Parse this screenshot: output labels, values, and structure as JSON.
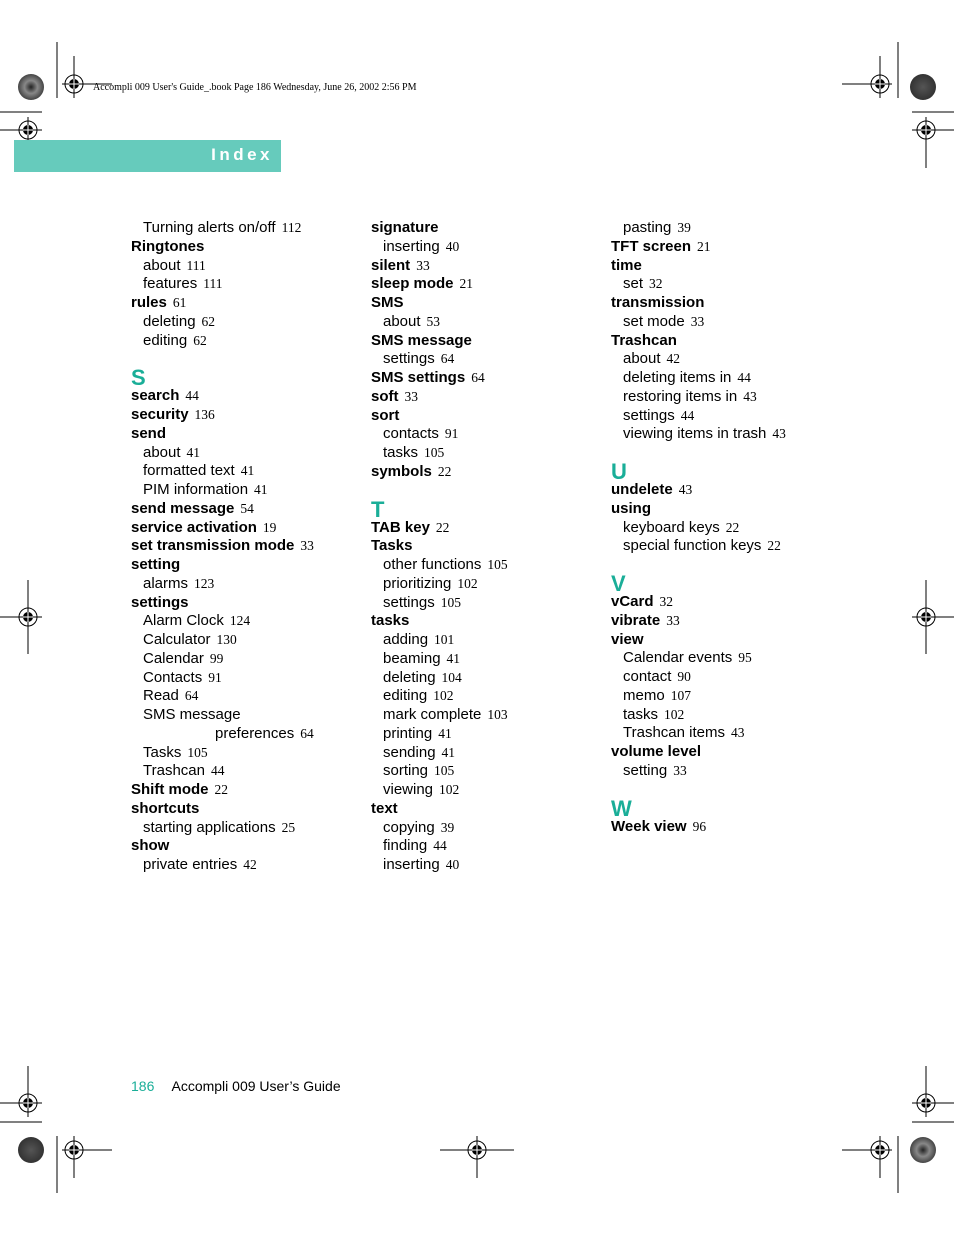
{
  "slug_line": "Accompli 009 User's Guide_.book  Page 186  Wednesday, June 26, 2002  2:56 PM",
  "banner_title": "Index",
  "columns": [
    [
      {
        "type": "sub",
        "text": "Turning alerts on/off",
        "page": "112"
      },
      {
        "type": "main",
        "text": "Ringtones",
        "page": ""
      },
      {
        "type": "sub",
        "text": "about",
        "page": "111"
      },
      {
        "type": "sub",
        "text": "features",
        "page": "111"
      },
      {
        "type": "main",
        "text": "rules",
        "page": "61"
      },
      {
        "type": "sub",
        "text": "deleting",
        "page": "62"
      },
      {
        "type": "sub",
        "text": "editing",
        "page": "62"
      },
      {
        "type": "letter",
        "text": "S"
      },
      {
        "type": "main",
        "text": "search",
        "page": "44"
      },
      {
        "type": "main",
        "text": "security",
        "page": "136"
      },
      {
        "type": "main",
        "text": "send",
        "page": ""
      },
      {
        "type": "sub",
        "text": "about",
        "page": "41"
      },
      {
        "type": "sub",
        "text": "formatted text",
        "page": "41"
      },
      {
        "type": "sub",
        "text": "PIM information",
        "page": "41"
      },
      {
        "type": "main",
        "text": "send message",
        "page": "54"
      },
      {
        "type": "main",
        "text": "service activation",
        "page": "19"
      },
      {
        "type": "main",
        "text": "set transmission mode",
        "page": "33"
      },
      {
        "type": "main",
        "text": "setting",
        "page": ""
      },
      {
        "type": "sub",
        "text": "alarms",
        "page": "123"
      },
      {
        "type": "main",
        "text": "settings",
        "page": ""
      },
      {
        "type": "sub",
        "text": "Alarm Clock",
        "page": "124"
      },
      {
        "type": "sub",
        "text": "Calculator",
        "page": "130"
      },
      {
        "type": "sub",
        "text": "Calendar",
        "page": "99"
      },
      {
        "type": "sub",
        "text": "Contacts",
        "page": "91"
      },
      {
        "type": "sub",
        "text": "Read",
        "page": "64"
      },
      {
        "type": "sub",
        "text": "SMS message",
        "page": ""
      },
      {
        "type": "sub2",
        "text": "preferences",
        "page": "64"
      },
      {
        "type": "sub",
        "text": "Tasks",
        "page": "105"
      },
      {
        "type": "sub",
        "text": "Trashcan",
        "page": "44"
      },
      {
        "type": "main",
        "text": "Shift mode",
        "page": "22"
      },
      {
        "type": "main",
        "text": "shortcuts",
        "page": ""
      },
      {
        "type": "sub",
        "text": "starting applications",
        "page": "25"
      },
      {
        "type": "main",
        "text": "show",
        "page": ""
      },
      {
        "type": "sub",
        "text": "private entries",
        "page": "42"
      }
    ],
    [
      {
        "type": "main",
        "text": "signature",
        "page": ""
      },
      {
        "type": "sub",
        "text": "inserting",
        "page": "40"
      },
      {
        "type": "main",
        "text": "silent",
        "page": "33"
      },
      {
        "type": "main",
        "text": "sleep mode",
        "page": "21"
      },
      {
        "type": "main",
        "text": "SMS",
        "page": ""
      },
      {
        "type": "sub",
        "text": "about",
        "page": "53"
      },
      {
        "type": "main",
        "text": "SMS message",
        "page": ""
      },
      {
        "type": "sub",
        "text": "settings",
        "page": "64"
      },
      {
        "type": "main",
        "text": "SMS settings",
        "page": "64"
      },
      {
        "type": "main",
        "text": "soft",
        "page": "33"
      },
      {
        "type": "main",
        "text": "sort",
        "page": ""
      },
      {
        "type": "sub",
        "text": "contacts",
        "page": "91"
      },
      {
        "type": "sub",
        "text": "tasks",
        "page": "105"
      },
      {
        "type": "main",
        "text": "symbols",
        "page": "22"
      },
      {
        "type": "letter",
        "text": "T"
      },
      {
        "type": "main",
        "text": "TAB key",
        "page": "22"
      },
      {
        "type": "main",
        "text": "Tasks",
        "page": ""
      },
      {
        "type": "sub",
        "text": "other functions",
        "page": "105"
      },
      {
        "type": "sub",
        "text": "prioritizing",
        "page": "102"
      },
      {
        "type": "sub",
        "text": "settings",
        "page": "105"
      },
      {
        "type": "main",
        "text": "tasks",
        "page": ""
      },
      {
        "type": "sub",
        "text": "adding",
        "page": "101"
      },
      {
        "type": "sub",
        "text": "beaming",
        "page": "41"
      },
      {
        "type": "sub",
        "text": "deleting",
        "page": "104"
      },
      {
        "type": "sub",
        "text": "editing",
        "page": "102"
      },
      {
        "type": "sub",
        "text": "mark complete",
        "page": "103"
      },
      {
        "type": "sub",
        "text": "printing",
        "page": "41"
      },
      {
        "type": "sub",
        "text": "sending",
        "page": "41"
      },
      {
        "type": "sub",
        "text": "sorting",
        "page": "105"
      },
      {
        "type": "sub",
        "text": "viewing",
        "page": "102"
      },
      {
        "type": "main",
        "text": "text",
        "page": ""
      },
      {
        "type": "sub",
        "text": "copying",
        "page": "39"
      },
      {
        "type": "sub",
        "text": "finding",
        "page": "44"
      },
      {
        "type": "sub",
        "text": "inserting",
        "page": "40"
      }
    ],
    [
      {
        "type": "sub",
        "text": "pasting",
        "page": "39"
      },
      {
        "type": "main",
        "text": "TFT screen",
        "page": "21"
      },
      {
        "type": "main",
        "text": "time",
        "page": ""
      },
      {
        "type": "sub",
        "text": "set",
        "page": "32"
      },
      {
        "type": "main",
        "text": "transmission",
        "page": ""
      },
      {
        "type": "sub",
        "text": "set mode",
        "page": "33"
      },
      {
        "type": "main",
        "text": "Trashcan",
        "page": ""
      },
      {
        "type": "sub",
        "text": "about",
        "page": "42"
      },
      {
        "type": "sub",
        "text": "deleting items in",
        "page": "44"
      },
      {
        "type": "sub",
        "text": "restoring items in",
        "page": "43"
      },
      {
        "type": "sub",
        "text": "settings",
        "page": "44"
      },
      {
        "type": "sub",
        "text": "viewing items in trash",
        "page": "43"
      },
      {
        "type": "letter",
        "text": "U"
      },
      {
        "type": "main",
        "text": "undelete",
        "page": "43"
      },
      {
        "type": "main",
        "text": "using",
        "page": ""
      },
      {
        "type": "sub",
        "text": "keyboard keys",
        "page": "22"
      },
      {
        "type": "sub",
        "text": "special function keys",
        "page": "22"
      },
      {
        "type": "letter",
        "text": "V"
      },
      {
        "type": "main",
        "text": "vCard",
        "page": "32"
      },
      {
        "type": "main",
        "text": "vibrate",
        "page": "33"
      },
      {
        "type": "main",
        "text": "view",
        "page": ""
      },
      {
        "type": "sub",
        "text": "Calendar events",
        "page": "95"
      },
      {
        "type": "sub",
        "text": "contact",
        "page": "90"
      },
      {
        "type": "sub",
        "text": "memo",
        "page": "107"
      },
      {
        "type": "sub",
        "text": "tasks",
        "page": "102"
      },
      {
        "type": "sub",
        "text": "Trashcan items",
        "page": "43"
      },
      {
        "type": "main",
        "text": "volume level",
        "page": ""
      },
      {
        "type": "sub",
        "text": "setting",
        "page": "33"
      },
      {
        "type": "letter",
        "text": "W"
      },
      {
        "type": "main",
        "text": "Week view",
        "page": "96"
      }
    ]
  ],
  "footer": {
    "page_number": "186",
    "title": "Accompli 009 User’s Guide"
  },
  "colors": {
    "accent": "#1aae98",
    "banner": "#66cbbc"
  },
  "icons": [
    "registration-mark-icon",
    "color-target-icon",
    "crop-mark-icon"
  ]
}
